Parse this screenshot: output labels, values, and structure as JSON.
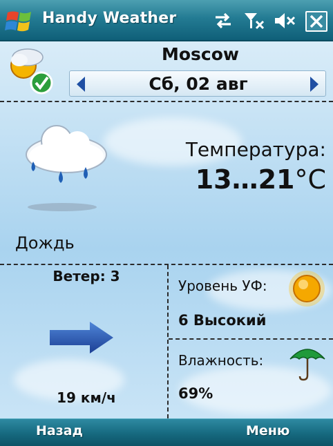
{
  "titlebar": {
    "app_title": "Handy Weather",
    "icons": [
      "windows-start-icon",
      "connectivity-icon",
      "signal-icon",
      "volume-icon",
      "close-icon"
    ]
  },
  "header": {
    "city": "Moscow",
    "date": "Сб, 02 авг",
    "icons": [
      "weather-status-icon",
      "previous-day-icon",
      "next-day-icon"
    ]
  },
  "current": {
    "condition": "Дождь",
    "condition_icon": "rain-cloud-icon",
    "temperature_label": "Температура:",
    "temperature_range": "13…21",
    "temperature_unit": "°C"
  },
  "wind": {
    "label": "Ветер: 3",
    "speed": "19 км/ч",
    "direction_icon": "wind-direction-arrow-icon"
  },
  "uv": {
    "label": "Уровень УФ:",
    "value": "6 Высокий",
    "icon": "sun-icon"
  },
  "humidity": {
    "label": "Влажность:",
    "value": "69%",
    "icon": "umbrella-icon"
  },
  "softkeys": {
    "left": "Назад",
    "right": "Меню"
  },
  "colors": {
    "titlebar": "#237b93",
    "background": "#a9d3ef",
    "arrow": "#2050a8",
    "text": "#111111"
  }
}
